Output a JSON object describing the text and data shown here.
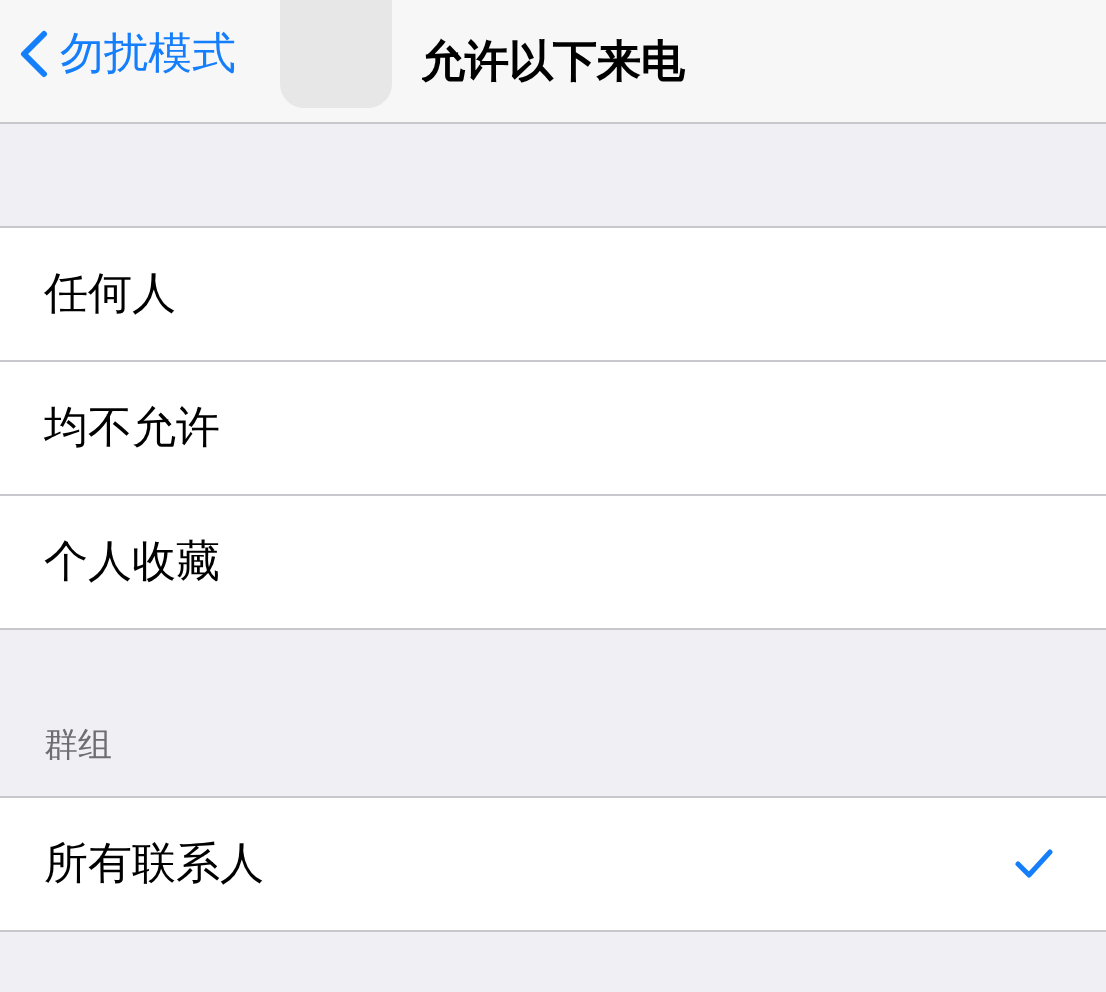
{
  "nav_bar": {
    "back": "勿扰模式",
    "title": "允许以下来电"
  },
  "sections": [
    {
      "items": [
        {
          "label": "任何人",
          "selected": false
        },
        {
          "label": "均不允许",
          "selected": false
        },
        {
          "label": "个人收藏",
          "selected": false
        }
      ]
    },
    {
      "header": "群组",
      "items": [
        {
          "label": "所有联系人",
          "selected": true
        }
      ]
    }
  ]
}
